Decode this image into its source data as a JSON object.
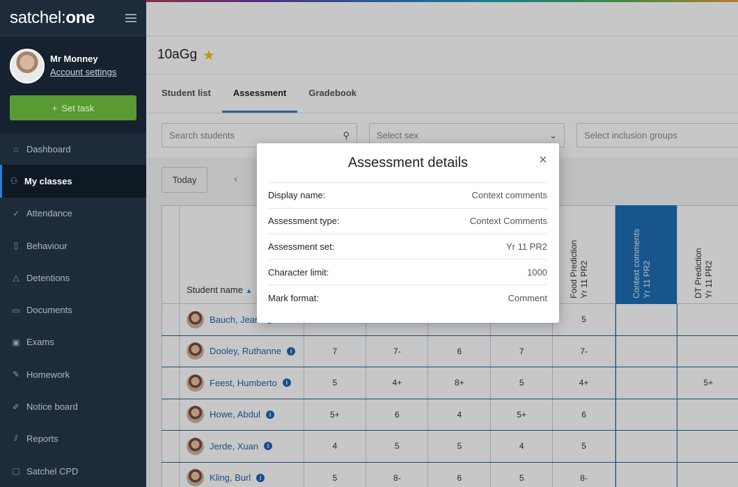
{
  "app": {
    "logo_main": "satchel",
    "logo_sep": ":",
    "logo_bold": "one"
  },
  "user": {
    "name": "Mr Monney",
    "account_link": "Account settings",
    "set_task_label": "Set task"
  },
  "nav": {
    "items": [
      {
        "label": "Dashboard",
        "icon": "home-icon",
        "glyph": "⌂"
      },
      {
        "label": "My classes",
        "icon": "users-icon",
        "glyph": "⚇"
      },
      {
        "label": "Attendance",
        "icon": "check-icon",
        "glyph": "✓"
      },
      {
        "label": "Behaviour",
        "icon": "clipboard-icon",
        "glyph": "▯"
      },
      {
        "label": "Detentions",
        "icon": "warning-icon",
        "glyph": "△"
      },
      {
        "label": "Documents",
        "icon": "document-icon",
        "glyph": "▭"
      },
      {
        "label": "Exams",
        "icon": "exam-icon",
        "glyph": "▣"
      },
      {
        "label": "Homework",
        "icon": "pencil-icon",
        "glyph": "✎"
      },
      {
        "label": "Notice board",
        "icon": "pin-icon",
        "glyph": "✐"
      },
      {
        "label": "Reports",
        "icon": "chart-icon",
        "glyph": "⫽"
      },
      {
        "label": "Satchel CPD",
        "icon": "cpd-icon",
        "glyph": "▢"
      }
    ],
    "active_index": 1
  },
  "class": {
    "title": "10aGg",
    "starred": true
  },
  "tabs": [
    {
      "label": "Student list"
    },
    {
      "label": "Assessment"
    },
    {
      "label": "Gradebook"
    }
  ],
  "active_tab": 1,
  "filters": {
    "search_placeholder": "Search students",
    "sex_placeholder": "Select sex",
    "inclusion_placeholder": "Select inclusion groups"
  },
  "toolbar": {
    "today_label": "Today"
  },
  "table": {
    "name_header": "Student name",
    "columns": [
      {
        "line1": "",
        "line2": ""
      },
      {
        "line1": "",
        "line2": ""
      },
      {
        "line1": "",
        "line2": ""
      },
      {
        "line1": "",
        "line2": ""
      },
      {
        "line1": "Food Prediction",
        "line2": "Yr 11 PR2"
      },
      {
        "line1": "Context comments",
        "line2": "Yr 11 PR2",
        "highlighted": true
      },
      {
        "line1": "DT Prediction",
        "line2": "Yr 11 PR2"
      }
    ],
    "rows": [
      {
        "name": "Bauch, Jean",
        "values": [
          "",
          "",
          "",
          "",
          "5",
          "",
          ""
        ]
      },
      {
        "name": "Dooley, Ruthanne",
        "values": [
          "7",
          "7-",
          "6",
          "7",
          "7-",
          "",
          ""
        ]
      },
      {
        "name": "Feest, Humberto",
        "values": [
          "5",
          "4+",
          "8+",
          "5",
          "4+",
          "",
          "5+"
        ]
      },
      {
        "name": "Howe, Abdul",
        "values": [
          "5+",
          "6",
          "4",
          "5+",
          "6",
          "",
          ""
        ]
      },
      {
        "name": "Jerde, Xuan",
        "values": [
          "4",
          "5",
          "5",
          "4",
          "5",
          "",
          ""
        ]
      },
      {
        "name": "Kling, Burl",
        "values": [
          "5",
          "8-",
          "6",
          "5",
          "8-",
          "",
          ""
        ]
      }
    ]
  },
  "modal": {
    "title": "Assessment details",
    "rows": [
      {
        "label": "Display name:",
        "value": "Context comments"
      },
      {
        "label": "Assessment type:",
        "value": "Context Comments"
      },
      {
        "label": "Assessment set:",
        "value": "Yr 11 PR2"
      },
      {
        "label": "Character limit:",
        "value": "1000"
      },
      {
        "label": "Mark format:",
        "value": "Comment"
      }
    ]
  },
  "colors": {
    "sidebar_bg": "#1d2b3a",
    "accent": "#2b7fd0",
    "set_task_green": "#5a9a33",
    "highlight_column": "#1f6db5",
    "star": "#f2c21b"
  }
}
